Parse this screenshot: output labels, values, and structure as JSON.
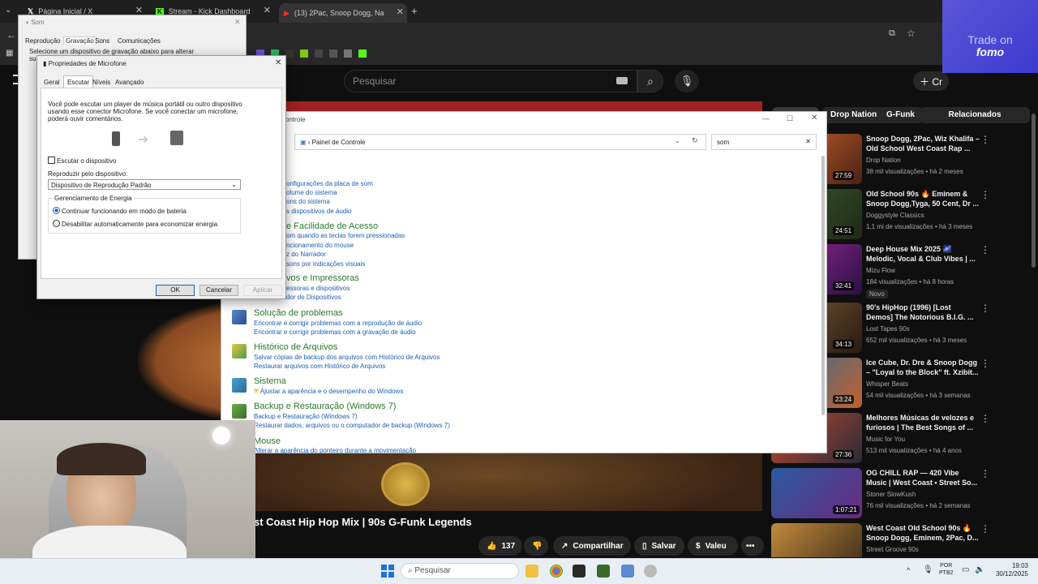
{
  "browser": {
    "tabs": [
      {
        "label": "Página Inicial / X"
      },
      {
        "label": "Stream - Kick Dashboard"
      },
      {
        "label": "(13) 2Pac, Snoop Dogg, Na"
      }
    ],
    "new_tab": "+"
  },
  "fomo": {
    "line1": "Trade on",
    "line2": "fomo"
  },
  "youtube": {
    "search_placeholder": "Pesquisar",
    "create_label": "Cr",
    "chips": [
      "Drop Nation",
      "G-Funk",
      "Relacionados"
    ],
    "video_title": "st Coast Hip Hop Mix | 90s G-Funk Legends",
    "actions": {
      "likes": "137",
      "share": "Compartilhar",
      "save": "Salvar",
      "thanks": "Valeu",
      "more": "•••"
    },
    "recommendations": [
      {
        "title": "Snoop Dogg, 2Pac, Wiz Khalifa – Old School West Coast Rap ...",
        "channel": "Drop Nation",
        "meta": "38 mil visualizações • há 2 meses",
        "duration": "27:59"
      },
      {
        "title": "Old School 90s 🔥 Eminem & Snoop Dogg,Tyga, 50 Cent, Dr ...",
        "channel": "Doggystyle Classics",
        "meta": "1,1 mi de visualizações • há 3 meses",
        "duration": "24:51"
      },
      {
        "title": "Deep House Mix 2025 🌌 Melodic, Vocal & Club Vibes | ...",
        "channel": "Mizu Flow",
        "meta": "184 visualizações • há 8 horas",
        "duration": "32:41",
        "badge": "Novo"
      },
      {
        "title": "90's HipHop (1996) [Lost Demos] The Notorious B.I.G. ...",
        "channel": "Lost Tapes 90s",
        "meta": "652 mil visualizações • há 3 meses",
        "duration": "34:13"
      },
      {
        "title": "Ice Cube, Dr. Dre & Snoop Dogg – \"Loyal to the Block\" ft. Xzibit...",
        "channel": "Whisper Beats",
        "meta": "54 mil visualizações • há 3 semanas",
        "duration": "23:24"
      },
      {
        "title": "Melhores Músicas de velozes e furiosos | The Best Songs of ...",
        "channel": "Music for You",
        "meta": "513 mil visualizações • há 4 anos",
        "duration": "27:36"
      },
      {
        "title": "OG CHILL RAP — 420 Vibe Music | West Coast • Street So...",
        "channel": "Stoner SlowKush",
        "meta": "76 mil visualizações • há 2 semanas",
        "duration": "1:07:21"
      },
      {
        "title": "West Coast Old School 90s 🔥 Snoop Dogg, Eminem, 2Pac, D...",
        "channel": "Street Groove 90s",
        "meta": "",
        "duration": ""
      }
    ]
  },
  "som_dialog": {
    "title": "Som",
    "tabs": [
      "Reprodução",
      "Gravação",
      "Sons",
      "Comunicações"
    ],
    "instruction": "Selecione um dispositivo de gravação abaixo para alterar suas"
  },
  "mic_dialog": {
    "title": "Propriedades de Microfone",
    "tabs": [
      "Geral",
      "Escutar",
      "Níveis",
      "Avançado"
    ],
    "description": "Você pode escutar um player de música portátil ou outro dispositivo usando esse conector Microfone. Se você conectar um microfone, poderá ouvir comentários.",
    "listen_checkbox": "Escutar o dispositivo",
    "playback_label": "Reproduzir pelo dispositivo:",
    "playback_value": "Dispositivo de Reprodução Padrão",
    "power_group": "Gerenciamento de Energia",
    "power_opt1": "Continuar funcionando em modo de bateria",
    "power_opt2": "Desabilitar automaticamente para economizar energia",
    "ok": "OK",
    "cancel": "Cancelar",
    "apply": "Aplicar"
  },
  "control_panel": {
    "title": "ontrole",
    "breadcrumb": "Painel de Controle",
    "search_value": "som",
    "sections": [
      {
        "header": "",
        "links": [
          "onfigurações da placa de som",
          "olume do sistema",
          "ons do sistema",
          "s dispositivos de áudio"
        ]
      },
      {
        "header": "e Facilidade de Acesso",
        "links": [
          "om quando as teclas forem pressionadas",
          "ncionamento do mouse",
          "z do Narrador",
          "sons por indicações visuais"
        ]
      },
      {
        "header": "vos e Impressoras",
        "links": [
          "essoras e dispositivos",
          "dor de Dispositivos"
        ]
      },
      {
        "header": "Solução de problemas",
        "links": [
          "Encontrar e corrigir problemas com a reprodução de áudio",
          "Encontrar e corrigir problemas com a gravação de áudio"
        ]
      },
      {
        "header": "Histórico de Arquivos",
        "links": [
          "Salvar cópias de backup dos arquivos com Histórico de Arquivos",
          "Restaurar arquivos com Histórico de Arquivos"
        ]
      },
      {
        "header": "Sistema",
        "links": [
          "Ajustar a aparência e o desempenho do Windows"
        ]
      },
      {
        "header": "Backup e Restauração (Windows 7)",
        "links": [
          "Backup e Restauração (Windows 7)",
          "Restaurar dados, arquivos ou o computador de backup (Windows 7)"
        ]
      },
      {
        "header": "Mouse",
        "links": [
          "Alterar a aparência do ponteiro durante a movimentação"
        ]
      }
    ]
  },
  "taskbar": {
    "search_placeholder": "Pesquisar",
    "lang1": "POR",
    "lang2": "PTB2",
    "time": "19:03",
    "date": "30/12/2025"
  }
}
